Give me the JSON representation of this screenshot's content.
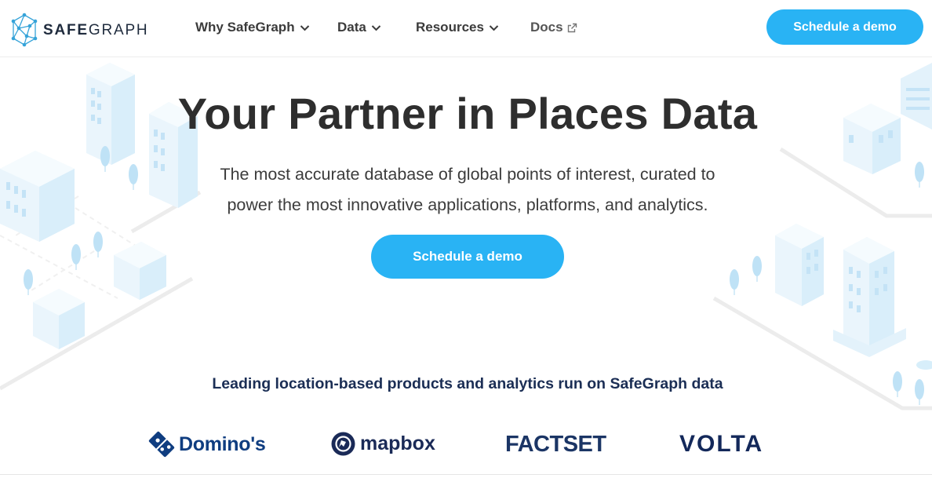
{
  "brand": {
    "logo_bold": "SAFE",
    "logo_light": "GRAPH"
  },
  "nav": {
    "items": [
      {
        "label": "Why SafeGraph",
        "icon": "chevron-down-icon"
      },
      {
        "label": "Data",
        "icon": "chevron-down-icon"
      },
      {
        "label": "Resources",
        "icon": "chevron-down-icon"
      },
      {
        "label": "Docs",
        "icon": "external-link-icon"
      }
    ],
    "cta_label": "Schedule a demo"
  },
  "hero": {
    "title": "Your Partner in Places Data",
    "subtitle_line1": "The most accurate database of global points of interest, curated to",
    "subtitle_line2": "power the most innovative applications, platforms, and analytics.",
    "cta_label": "Schedule a demo"
  },
  "partners": {
    "heading": "Leading location-based products and analytics run on SafeGraph data",
    "logos": [
      {
        "name": "Domino's",
        "icon": "dominos-logo-icon"
      },
      {
        "name": "mapbox",
        "icon": "mapbox-logo-icon"
      },
      {
        "name": "FACTSET"
      },
      {
        "name": "VOLTA"
      }
    ]
  },
  "colors": {
    "accent": "#29b3f4",
    "navy": "#1b2e55",
    "illustration": "#d3ebf8"
  }
}
